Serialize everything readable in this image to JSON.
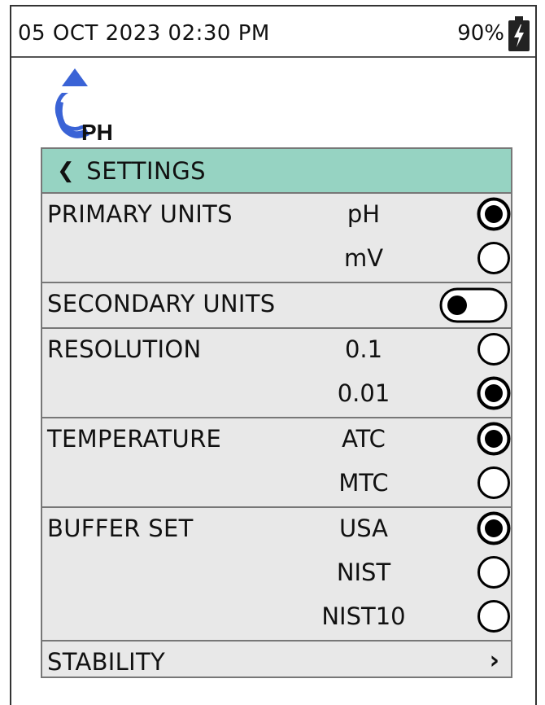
{
  "status": {
    "datetime": "05 OCT 2023 02:30 PM",
    "battery_percent": "90%",
    "battery_icon": "battery-charging-icon"
  },
  "logo": {
    "text": "PH",
    "icon": "water-drop-logo-icon",
    "color": "#3a63d6"
  },
  "header": {
    "back_icon": "chevron-left-icon",
    "title": "SETTINGS",
    "color": "#96d3c2"
  },
  "settings": {
    "primary_units": {
      "label": "PRIMARY UNITS",
      "options": [
        {
          "label": "pH",
          "selected": true
        },
        {
          "label": "mV",
          "selected": false
        }
      ]
    },
    "secondary_units": {
      "label": "SECONDARY UNITS",
      "enabled": false
    },
    "resolution": {
      "label": "RESOLUTION",
      "options": [
        {
          "label": "0.1",
          "selected": false
        },
        {
          "label": "0.01",
          "selected": true
        }
      ]
    },
    "temperature": {
      "label": "TEMPERATURE",
      "options": [
        {
          "label": "ATC",
          "selected": true
        },
        {
          "label": "MTC",
          "selected": false
        }
      ]
    },
    "buffer_set": {
      "label": "BUFFER SET",
      "options": [
        {
          "label": "USA",
          "selected": true
        },
        {
          "label": "NIST",
          "selected": false
        },
        {
          "label": "NIST10",
          "selected": false
        }
      ]
    },
    "stability": {
      "label": "STABILITY",
      "chevron": "chevron-right-icon"
    }
  }
}
